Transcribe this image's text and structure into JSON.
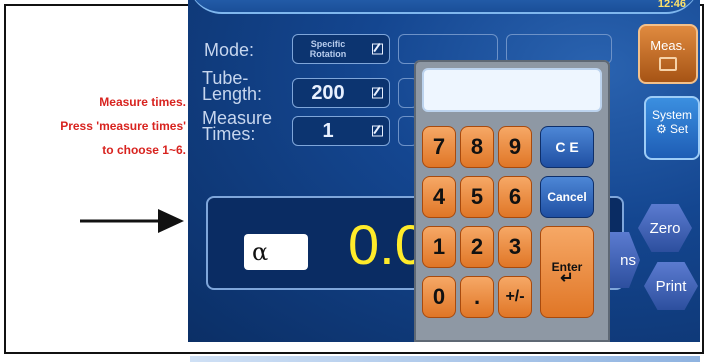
{
  "annotation": {
    "lines": [
      "Measure times.",
      "Press 'measure times'",
      "to choose  1~6."
    ]
  },
  "screen": {
    "clock": "12:46",
    "mode": {
      "label": "Mode:",
      "value_line1": "Specific",
      "value_line2": "Rotation"
    },
    "tube_length": {
      "label_line1": "Tube-",
      "label_line2": "Length:",
      "value": "200"
    },
    "measure_times": {
      "label_line1": "Measure",
      "label_line2": "Times:",
      "value": "1"
    },
    "alpha_symbol": "α",
    "reading": "0.0",
    "buttons": {
      "meas": "Meas.",
      "system_line1": "System",
      "system_line2": "Set",
      "zero": "Zero",
      "print": "Print",
      "partial_ms": "ns"
    }
  },
  "keypad": {
    "display_value": "",
    "keys_row1": [
      "7",
      "8",
      "9"
    ],
    "keys_row2": [
      "4",
      "5",
      "6"
    ],
    "keys_row3": [
      "1",
      "2",
      "3"
    ],
    "keys_row4": [
      "0",
      ".",
      "+/-"
    ],
    "ce": "C E",
    "cancel": "Cancel",
    "enter": "Enter"
  },
  "colors": {
    "annotation_text": "#d8231f",
    "screen_bg": "#0f3a78",
    "reading": "#ffeb2a",
    "key_orange": "#e07626",
    "key_blue": "#1f4fa2"
  }
}
